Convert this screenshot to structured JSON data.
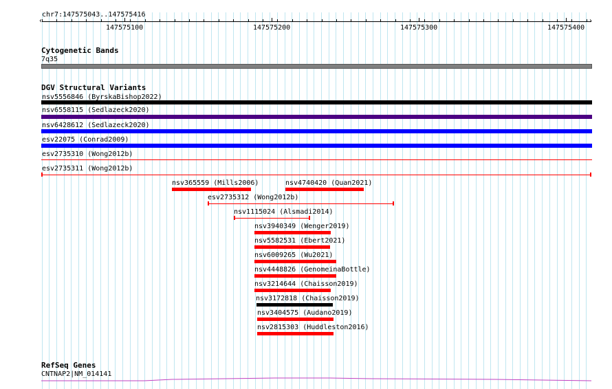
{
  "ruler": {
    "position": "chr7:147575043..147575416",
    "tick_labels": [
      "147575100",
      "147575200",
      "147575300",
      "147575400"
    ]
  },
  "tracks": {
    "cytoband": {
      "title": "Cytogenetic Bands",
      "band_label": "7q35",
      "band_color": "#808080"
    },
    "dgv": {
      "title": "DGV Structural Variants",
      "full_span_items": [
        {
          "label": "nsv5556846 (ByrskaBishop2022)",
          "color": "#000000",
          "style": "thick"
        },
        {
          "label": "nsv6558115 (Sedlazeck2020)",
          "color": "#4b0082",
          "style": "thick"
        },
        {
          "label": "nsv6428612 (Sedlazeck2020)",
          "color": "#0000ff",
          "style": "thick"
        },
        {
          "label": "esv22075 (Conrad2009)",
          "color": "#0000ff",
          "style": "thick"
        },
        {
          "label": "esv2735310 (Wong2012b)",
          "color": "#ff0000",
          "style": "thin"
        },
        {
          "label": "esv2735311 (Wong2012b)",
          "color": "#ff0000",
          "style": "thin-capped"
        }
      ],
      "packed_items": [
        {
          "label": "nsv365559 (Mills2006)",
          "color": "#ff0000",
          "style": "thick"
        },
        {
          "label": "nsv4740420 (Quan2021)",
          "color": "#ff0000",
          "style": "thick"
        },
        {
          "label": "esv2735312 (Wong2012b)",
          "color": "#ff0000",
          "style": "thin-capped"
        },
        {
          "label": "nsv1115024 (Alsmadi2014)",
          "color": "#ff0000",
          "style": "thin-capped"
        },
        {
          "label": "nsv3940349 (Wenger2019)",
          "color": "#ff0000",
          "style": "thick"
        },
        {
          "label": "nsv5582531 (Ebert2021)",
          "color": "#ff0000",
          "style": "thick"
        },
        {
          "label": "nsv6009265 (Wu2021)",
          "color": "#ff0000",
          "style": "thick"
        },
        {
          "label": "nsv4448826 (GenomeinaBottle)",
          "color": "#ff0000",
          "style": "thick"
        },
        {
          "label": "nsv3214644 (Chaisson2019)",
          "color": "#ff0000",
          "style": "thick"
        },
        {
          "label": "nsv3172818 (Chaisson2019)",
          "color": "#000000",
          "style": "thick"
        },
        {
          "label": "nsv3404575 (Audano2019)",
          "color": "#ff0000",
          "style": "thick"
        },
        {
          "label": "nsv2815303 (Huddleston2016)",
          "color": "#ff0000",
          "style": "thick"
        }
      ]
    },
    "refseq": {
      "title": "RefSeq Genes",
      "gene_label": "CNTNAP2|NM_014141",
      "color": "#c040c0"
    }
  }
}
